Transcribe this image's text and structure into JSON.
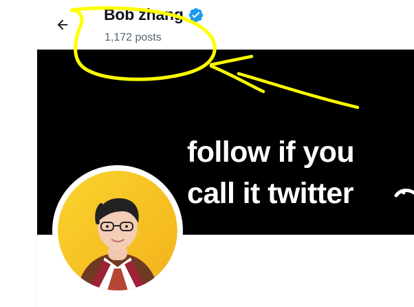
{
  "header": {
    "name": "Bob zhang",
    "post_count": "1,172 posts",
    "verified": true
  },
  "banner": {
    "line1": "follow if you",
    "line2": "call it twitter",
    "background": "#000000",
    "text_color": "#ffffff"
  },
  "icons": {
    "back": "left-arrow-icon",
    "verified": "verified-badge-icon",
    "banner_partial": "partial-emoji-icon"
  },
  "annotation": {
    "color": "#ffff00",
    "shape": "freehand-ellipse-with-arrow"
  },
  "colors": {
    "accent": "#1d9bf0",
    "text_primary": "#0f1419",
    "text_secondary": "#536471"
  }
}
